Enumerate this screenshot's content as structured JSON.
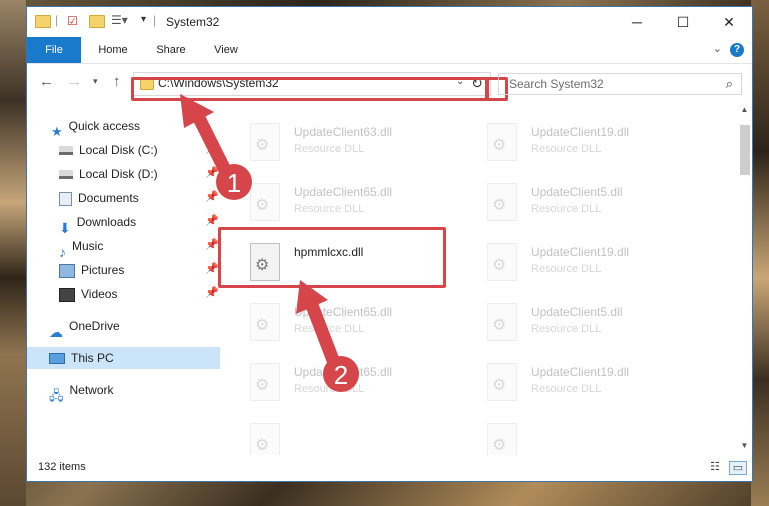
{
  "window": {
    "title": "System32"
  },
  "window_controls": {
    "minimize": "─",
    "maximize": "☐",
    "close": "✕"
  },
  "ribbon": {
    "tabs": [
      "File",
      "Home",
      "Share",
      "View"
    ],
    "help": "?"
  },
  "address": {
    "path": "C:\\Windows\\System32",
    "search_placeholder": "Search System32"
  },
  "sidebar": {
    "items": [
      {
        "label": "Quick access",
        "icon": "star-icon"
      },
      {
        "label": "Local Disk (C:)",
        "icon": "drive-icon",
        "pinned": true
      },
      {
        "label": "Local Disk (D:)",
        "icon": "drive-icon",
        "pinned": true
      },
      {
        "label": "Documents",
        "icon": "documents-icon",
        "pinned": true
      },
      {
        "label": "Downloads",
        "icon": "download-icon",
        "pinned": true
      },
      {
        "label": "Music",
        "icon": "music-icon",
        "pinned": true
      },
      {
        "label": "Pictures",
        "icon": "pictures-icon",
        "pinned": true
      },
      {
        "label": "Videos",
        "icon": "videos-icon",
        "pinned": true
      },
      {
        "label": "OneDrive",
        "icon": "cloud-icon"
      },
      {
        "label": "This PC",
        "icon": "computer-icon",
        "selected": true
      },
      {
        "label": "Network",
        "icon": "network-icon"
      }
    ]
  },
  "files": [
    {
      "name": "UpdateClient63.dll",
      "type": "Resource DLL"
    },
    {
      "name": "UpdateClient19.dll",
      "type": "Resource DLL"
    },
    {
      "name": "UpdateClient65.dll",
      "type": "Resource DLL"
    },
    {
      "name": "UpdateClient5.dll",
      "type": "Resource DLL"
    },
    {
      "name": "hpmmlcxc.dll",
      "type": "",
      "highlighted": true
    },
    {
      "name": "UpdateClient19.dll",
      "type": "Resource DLL"
    },
    {
      "name": "UpdateClient65.dll",
      "type": "Resource DLL"
    },
    {
      "name": "UpdateClient5.dll",
      "type": "Resource DLL"
    },
    {
      "name": "UpdateClient65.dll",
      "type": "Resource DLL"
    },
    {
      "name": "UpdateClient19.dll",
      "type": "Resource DLL"
    },
    {
      "name": "",
      "type": ""
    },
    {
      "name": "",
      "type": ""
    }
  ],
  "status": {
    "item_count": "132 items"
  },
  "annotations": {
    "step1": "1",
    "step2": "2",
    "color": "#d6454a"
  }
}
